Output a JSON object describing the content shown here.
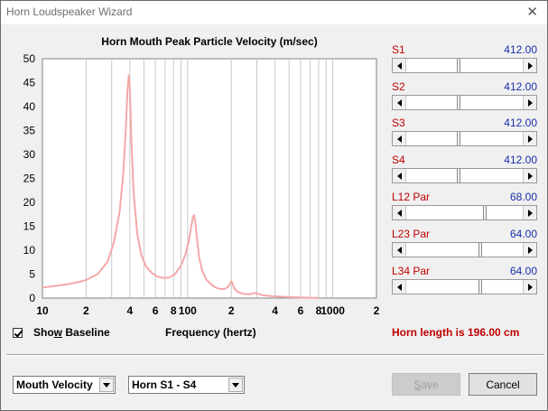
{
  "window": {
    "title": "Horn Loudspeaker Wizard"
  },
  "icons": {
    "close": "close-icon"
  },
  "chart_data": {
    "type": "line",
    "title": "Horn Mouth Peak Particle Velocity (m/sec)",
    "xlabel": "Frequency (hertz)",
    "ylabel": "",
    "xscale": "log",
    "xlim": [
      10,
      2000
    ],
    "ylim": [
      0,
      50
    ],
    "yticks": [
      0,
      5,
      10,
      15,
      20,
      25,
      30,
      35,
      40,
      45,
      50
    ],
    "xtick_labels": [
      "10",
      "2",
      "4",
      "6",
      "8",
      "100",
      "2",
      "4",
      "6",
      "8",
      "1000",
      "2"
    ],
    "xtick_values": [
      10,
      20,
      40,
      60,
      80,
      100,
      200,
      400,
      600,
      800,
      1000,
      2000
    ],
    "grid": true,
    "line_color": "#f4a8a8",
    "series": [
      {
        "x": [
          10,
          12,
          15,
          18,
          20,
          24,
          28,
          31,
          34,
          36,
          37.5,
          38.5,
          39.3,
          40,
          41,
          42.5,
          45,
          48,
          52,
          57,
          62,
          68,
          75,
          82,
          90,
          96,
          102,
          106,
          109,
          111,
          113,
          116,
          120,
          126,
          135,
          150,
          165,
          180,
          190,
          196,
          200,
          204,
          210,
          220,
          240,
          260,
          280,
          290,
          300,
          320,
          350,
          400,
          500,
          600,
          700,
          800
        ],
        "y": [
          2.2,
          2.5,
          2.9,
          3.4,
          3.8,
          5.0,
          7.5,
          11.5,
          18.0,
          26.0,
          35.0,
          43.0,
          46.5,
          44.0,
          33.0,
          22.0,
          13.5,
          9.0,
          6.5,
          5.2,
          4.5,
          4.2,
          4.3,
          5.0,
          6.8,
          8.8,
          12.0,
          15.0,
          17.0,
          17.3,
          16.0,
          12.5,
          8.5,
          5.8,
          3.8,
          2.5,
          1.9,
          1.9,
          2.3,
          3.1,
          3.5,
          3.0,
          2.0,
          1.3,
          0.9,
          0.8,
          0.9,
          1.1,
          1.0,
          0.7,
          0.5,
          0.35,
          0.2,
          0.12,
          0.08,
          0.05
        ]
      }
    ]
  },
  "baseline": {
    "label_pre": "Sho",
    "label_accel": "w",
    "label_post": " Baseline",
    "checked": true
  },
  "sliders": [
    {
      "label": "S1",
      "value": "412.00",
      "position": 0.45
    },
    {
      "label": "S2",
      "value": "412.00",
      "position": 0.45
    },
    {
      "label": "S3",
      "value": "412.00",
      "position": 0.45
    },
    {
      "label": "S4",
      "value": "412.00",
      "position": 0.45
    },
    {
      "label": "L12  Par",
      "value": "68.00",
      "position": 0.68
    },
    {
      "label": "L23  Par",
      "value": "64.00",
      "position": 0.64
    },
    {
      "label": "L34  Par",
      "value": "64.00",
      "position": 0.64
    }
  ],
  "horn_length": "Horn length is 196.00 cm",
  "selects": {
    "mode": {
      "value": "Mouth Velocity"
    },
    "section": {
      "value": "Horn S1 - S4"
    }
  },
  "buttons": {
    "save_accel": "S",
    "save_rest": "ave",
    "cancel": "Cancel"
  }
}
